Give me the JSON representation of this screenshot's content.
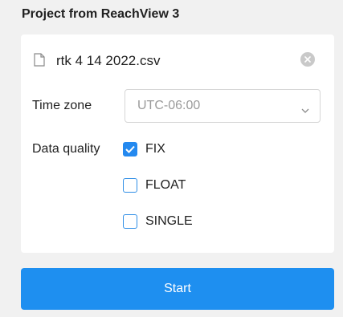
{
  "header": {
    "title": "Project from ReachView 3"
  },
  "file": {
    "name": "rtk 4 14 2022.csv",
    "icon": "file-icon",
    "clear_icon": "close-icon"
  },
  "timezone": {
    "label": "Time zone",
    "value": "UTC-06:00",
    "icon": "chevron-down-icon"
  },
  "data_quality": {
    "label": "Data quality",
    "options": [
      {
        "label": "FIX",
        "checked": true
      },
      {
        "label": "FLOAT",
        "checked": false
      },
      {
        "label": "SINGLE",
        "checked": false
      }
    ]
  },
  "actions": {
    "start_label": "Start"
  },
  "colors": {
    "accent": "#1e8ff0",
    "background": "#f1f1f1",
    "card": "#ffffff"
  }
}
